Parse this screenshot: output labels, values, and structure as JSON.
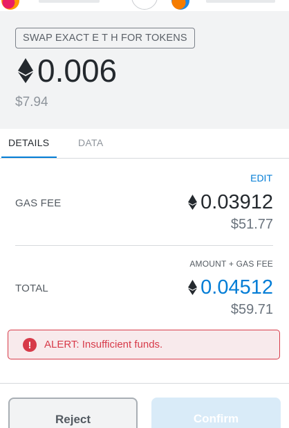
{
  "transaction": {
    "method": "SWAP EXACT E T H FOR TOKENS",
    "amount_eth": "0.006",
    "amount_fiat": "$7.94"
  },
  "tabs": [
    {
      "label": "DETAILS",
      "active": true
    },
    {
      "label": "DATA",
      "active": false
    }
  ],
  "details": {
    "edit_label": "EDIT",
    "gas_fee": {
      "label": "GAS FEE",
      "eth": "0.03912",
      "fiat": "$51.77"
    },
    "total": {
      "subheading": "AMOUNT + GAS FEE",
      "label": "TOTAL",
      "eth": "0.04512",
      "fiat": "$59.71"
    }
  },
  "alert": {
    "text": "ALERT: Insufficient funds.",
    "icon": "exclamation-circle-icon"
  },
  "footer": {
    "reject_label": "Reject",
    "confirm_label": "Confirm"
  },
  "colors": {
    "accent": "#037dd6",
    "error": "#d73a49",
    "confirm_disabled": "#d9ebf8"
  }
}
